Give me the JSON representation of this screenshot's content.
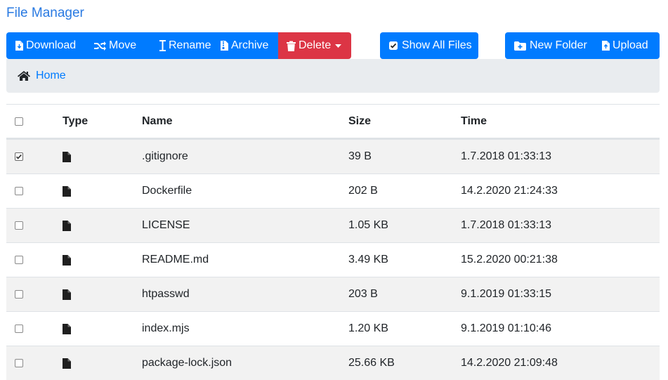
{
  "app": {
    "title": "File Manager"
  },
  "toolbar": {
    "download": "Download",
    "move": "Move",
    "rename": "Rename",
    "archive": "Archive",
    "delete": "Delete",
    "show_all_files": "Show All Files",
    "show_all_checked": true,
    "new_folder": "New Folder",
    "upload": "Upload"
  },
  "breadcrumb": {
    "home": "Home"
  },
  "table": {
    "headers": {
      "type": "Type",
      "name": "Name",
      "size": "Size",
      "time": "Time"
    },
    "rows": [
      {
        "checked": true,
        "name": ".gitignore",
        "size": "39 B",
        "time": "1.7.2018 01:33:13"
      },
      {
        "checked": false,
        "name": "Dockerfile",
        "size": "202 B",
        "time": "14.2.2020 21:24:33"
      },
      {
        "checked": false,
        "name": "LICENSE",
        "size": "1.05 KB",
        "time": "1.7.2018 01:33:13"
      },
      {
        "checked": false,
        "name": "README.md",
        "size": "3.49 KB",
        "time": "15.2.2020 00:21:38"
      },
      {
        "checked": false,
        "name": "htpasswd",
        "size": "203 B",
        "time": "9.1.2019 01:33:15"
      },
      {
        "checked": false,
        "name": "index.mjs",
        "size": "1.20 KB",
        "time": "9.1.2019 01:10:46"
      },
      {
        "checked": false,
        "name": "package-lock.json",
        "size": "25.66 KB",
        "time": "14.2.2020 21:09:48"
      }
    ]
  },
  "colors": {
    "primary": "#007bff",
    "danger": "#dc3545",
    "breadcrumb_bg": "#e9ecef",
    "stripe": "#f2f2f2"
  },
  "icons": [
    "file-download-icon",
    "shuffle-icon",
    "text-cursor-icon",
    "file-archive-icon",
    "trash-icon",
    "caret-down-icon",
    "checkbox-icon",
    "folder-plus-icon",
    "file-upload-icon",
    "home-icon",
    "file-icon"
  ]
}
